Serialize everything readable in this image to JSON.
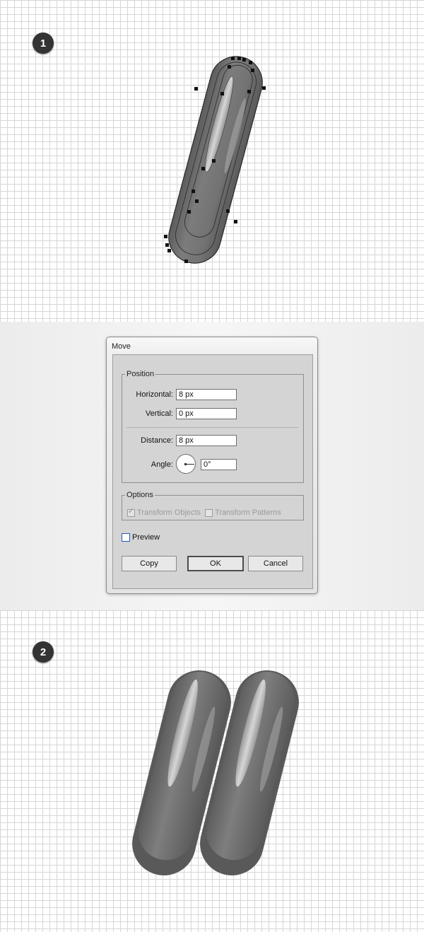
{
  "steps": [
    {
      "number": "1"
    },
    {
      "number": "2"
    }
  ],
  "colors": {
    "grid_line": "#d6d6d6",
    "badge_bg": "#333333",
    "shape_dark": "#6b6b6b",
    "shape_mid": "#8a8a8a",
    "shape_highlight": "#d8d8d8",
    "preview_border": "#2457b5"
  },
  "dialog": {
    "title": "Move",
    "position": {
      "legend": "Position",
      "horizontal_label": "Horizontal:",
      "horizontal_value": "8 px",
      "vertical_label": "Vertical:",
      "vertical_value": "0 px",
      "distance_label": "Distance:",
      "distance_value": "8 px",
      "angle_label": "Angle:",
      "angle_value": "0°"
    },
    "options": {
      "legend": "Options",
      "transform_objects_label": "Transform Objects",
      "transform_objects_checked": true,
      "transform_patterns_label": "Transform Patterns",
      "transform_patterns_checked": false
    },
    "preview_label": "Preview",
    "preview_checked": false,
    "buttons": {
      "copy": "Copy",
      "ok": "OK",
      "cancel": "Cancel"
    }
  }
}
